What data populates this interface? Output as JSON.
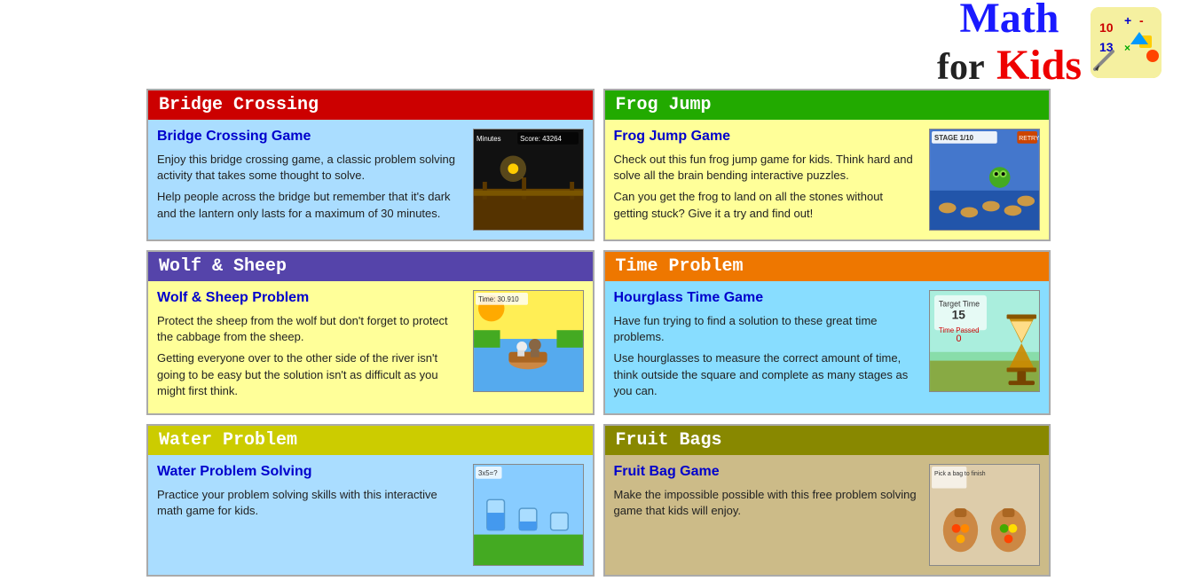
{
  "header": {
    "title_math": "Math",
    "title_for": "for",
    "title_kids": "Kids"
  },
  "sections": [
    {
      "id": "bridge-crossing",
      "header_text": "Bridge Crossing",
      "header_color": "red",
      "body_color": "blue-bg",
      "title": "Bridge Crossing Game",
      "desc1": "Enjoy this bridge crossing game, a classic problem solving activity that takes some thought to solve.",
      "desc2": "Help people across the bridge but remember that it's dark and the lantern only lasts for a maximum of 30 minutes.",
      "thumb_class": "thumb-bridge"
    },
    {
      "id": "frog-jump",
      "header_text": "Frog Jump",
      "header_color": "green",
      "body_color": "yellow-bg",
      "title": "Frog Jump Game",
      "desc1": "Check out this fun frog jump game for kids. Think hard and solve all the brain bending interactive puzzles.",
      "desc2": "Can you get the frog to land on all the stones without getting stuck? Give it a try and find out!",
      "thumb_class": "thumb-frog"
    },
    {
      "id": "wolf-sheep",
      "header_text": "Wolf & Sheep",
      "header_color": "purple",
      "body_color": "yellow-bg",
      "title": "Wolf & Sheep Problem",
      "desc1": "Protect the sheep from the wolf but don't forget to protect the cabbage from the sheep.",
      "desc2": "Getting everyone over to the other side of the river isn't going to be easy but the solution isn't as difficult as you might first think.",
      "thumb_class": "thumb-wolf"
    },
    {
      "id": "time-problem",
      "header_text": "Time Problem",
      "header_color": "orange",
      "body_color": "light-blue-bg",
      "title": "Hourglass Time Game",
      "desc1": "Have fun trying to find a solution to these great time problems.",
      "desc2": "Use hourglasses to measure the correct amount of time, think outside the square and complete as many stages as you can.",
      "thumb_class": "thumb-hourglass"
    },
    {
      "id": "water-problem",
      "header_text": "Water Problem",
      "header_color": "yellow-header",
      "body_color": "blue-bg",
      "title": "Water Problem Solving",
      "desc1": "Practice your problem solving skills with this interactive math game for kids.",
      "desc2": "",
      "thumb_class": "thumb-water"
    },
    {
      "id": "fruit-bags",
      "header_text": "Fruit Bags",
      "header_color": "olive",
      "body_color": "tan-bg",
      "title": "Fruit Bag Game",
      "desc1": "Make the impossible possible with this free problem solving game that kids will enjoy.",
      "desc2": "",
      "thumb_class": "thumb-fruit"
    }
  ]
}
